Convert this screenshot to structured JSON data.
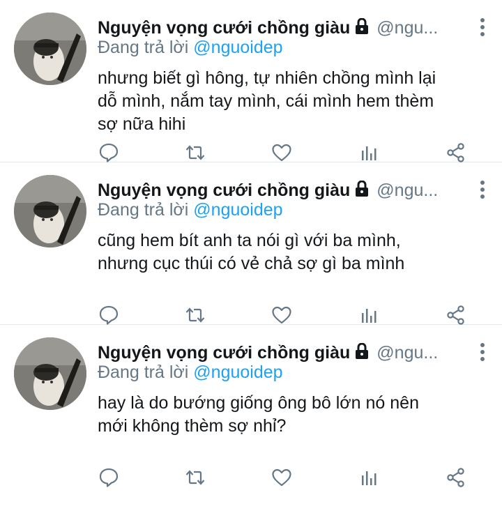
{
  "colors": {
    "text": "#14171a",
    "muted": "#657786",
    "link": "#1da1f2",
    "divider": "#e1e8ed"
  },
  "tweets": [
    {
      "author_name": "Nguyện vọng cưới chồng giàu",
      "handle": "@ngu...",
      "reply_prefix": "Đang trả lời",
      "reply_to": "@nguoidep",
      "text_lines": [
        "nhưng biết gì hông, tự nhiên chồng mình lại",
        "dỗ mình, nắm tay mình, cái mình hem thèm",
        "sợ nữa hihi"
      ]
    },
    {
      "author_name": "Nguyện vọng cưới chồng giàu",
      "handle": "@ngu...",
      "reply_prefix": "Đang trả lời",
      "reply_to": "@nguoidep",
      "text_lines": [
        "cũng hem bít anh ta nói gì với ba mình,",
        "nhưng cục thúi có vẻ chả sợ gì ba mình"
      ]
    },
    {
      "author_name": "Nguyện vọng cưới chồng giàu",
      "handle": "@ngu...",
      "reply_prefix": "Đang trả lời",
      "reply_to": "@nguoidep",
      "text_lines": [
        "hay là do bướng giống ông bô lớn nó nên",
        "mới không thèm sợ nhỉ?"
      ]
    }
  ],
  "icons": [
    "lock-icon",
    "more-vertical-icon",
    "reply-icon",
    "retweet-icon",
    "like-heart-icon",
    "analytics-bar-icon",
    "share-icon"
  ]
}
